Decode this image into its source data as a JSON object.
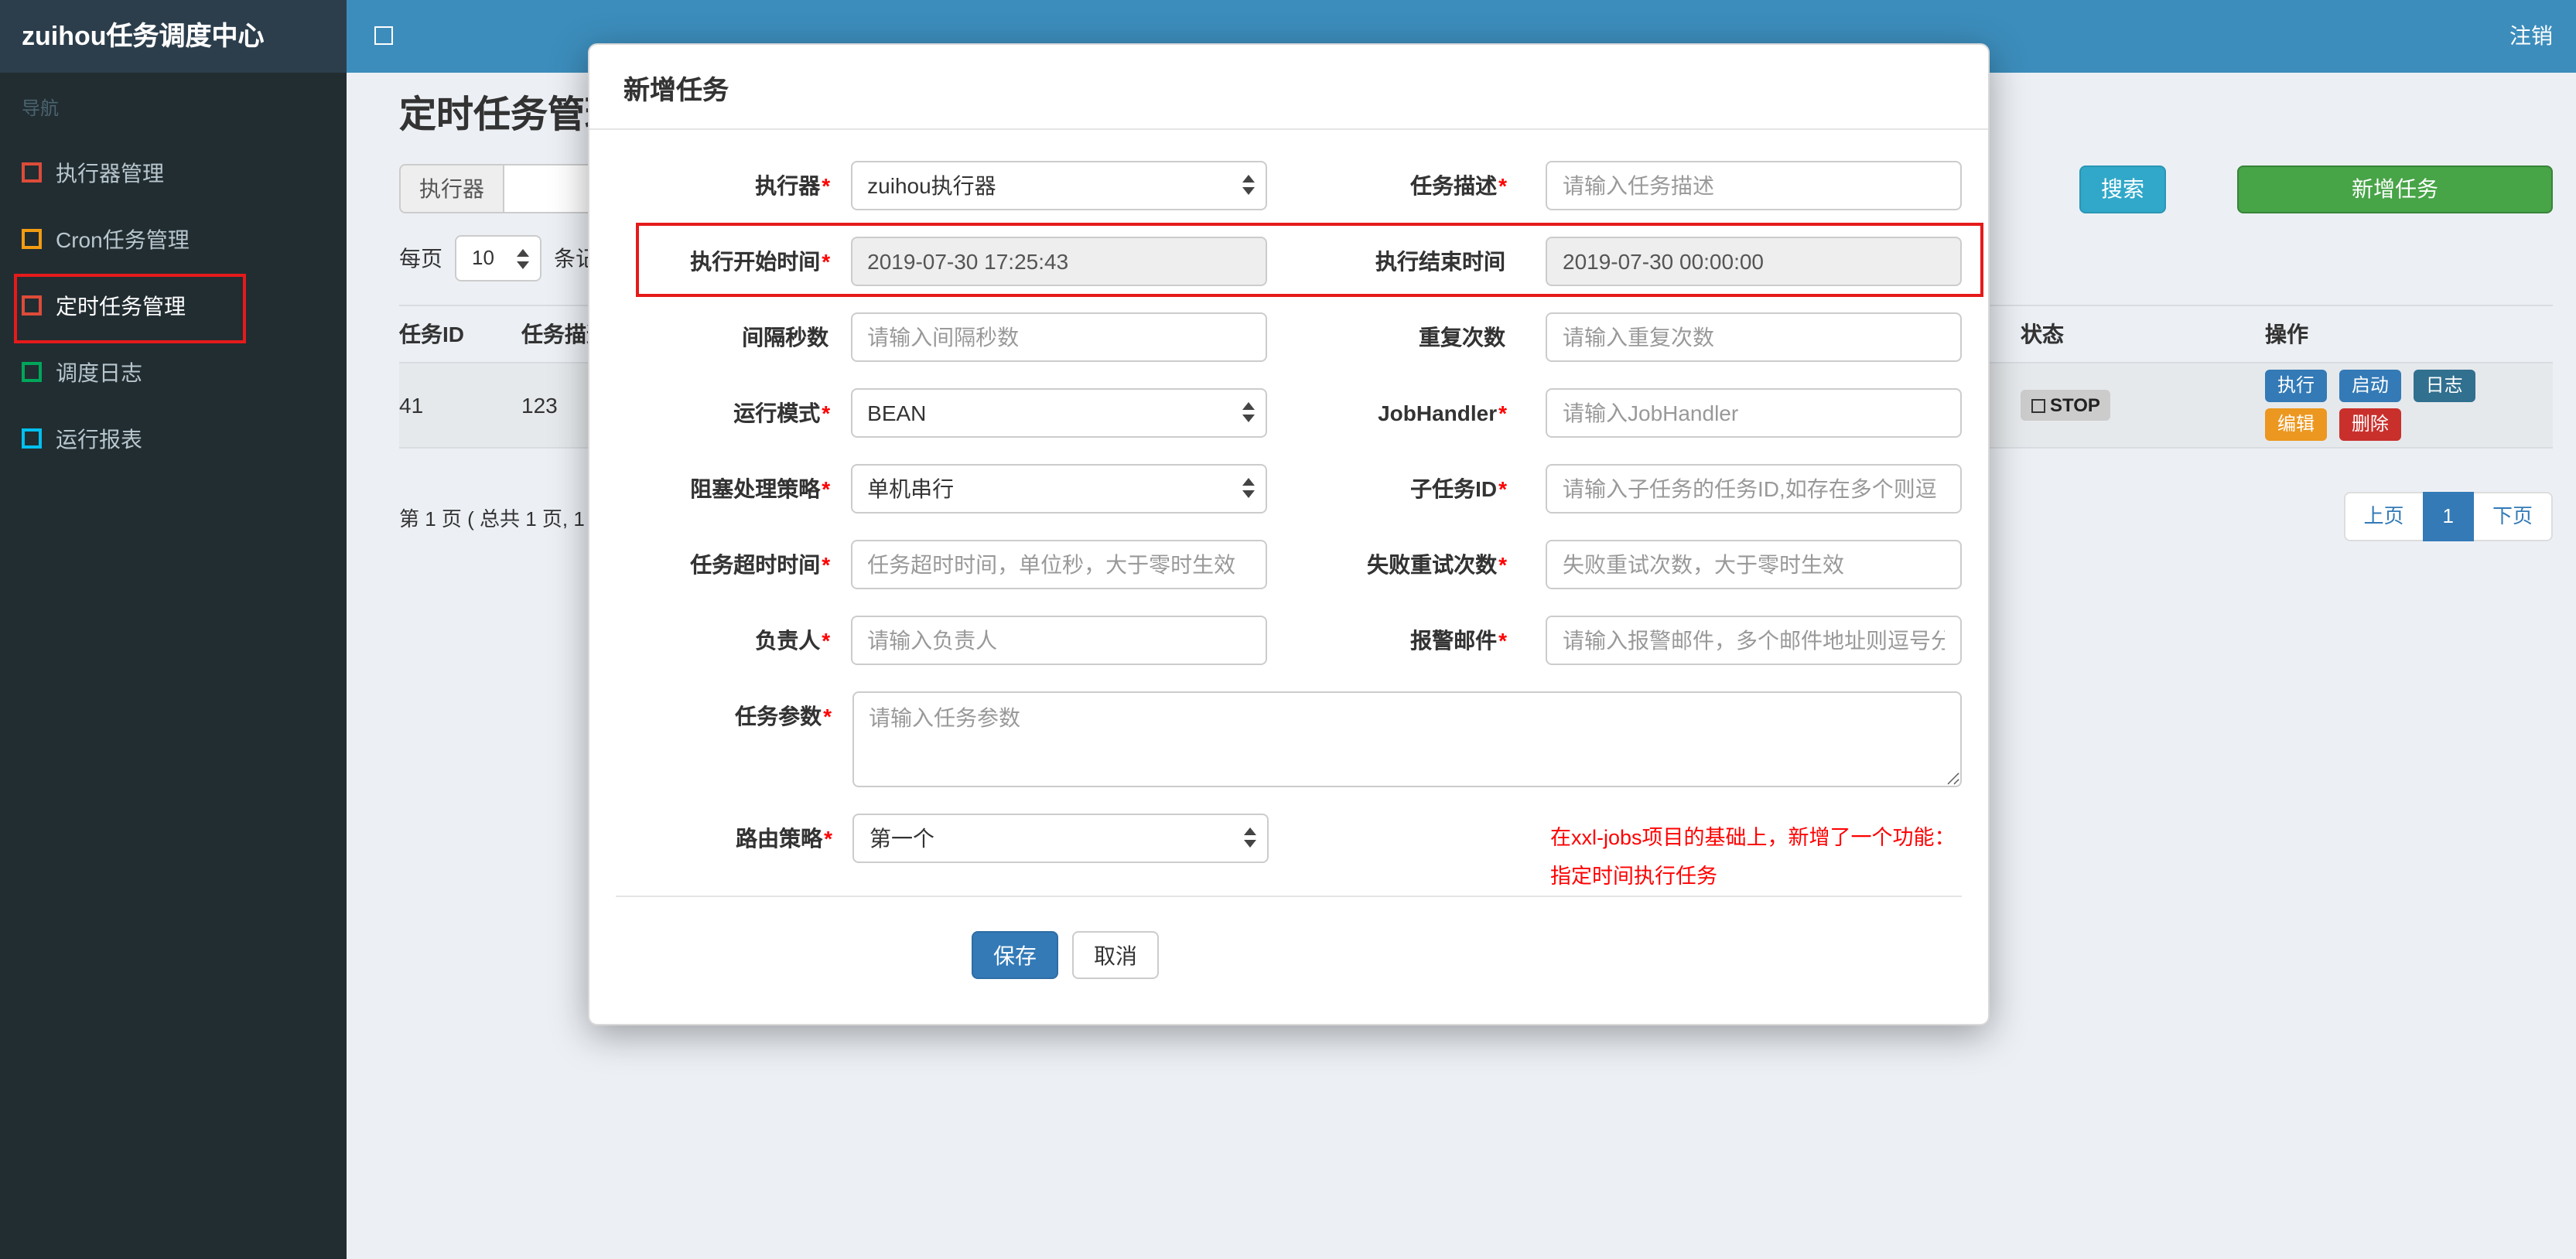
{
  "topbar": {
    "brand": "zuihou任务调度中心",
    "logout": "注销"
  },
  "sidebar": {
    "header": "导航",
    "items": [
      {
        "label": "执行器管理",
        "color": "#dd4b39",
        "active": false
      },
      {
        "label": "Cron任务管理",
        "color": "#f39c12",
        "active": false
      },
      {
        "label": "定时任务管理",
        "color": "#dd4b39",
        "active": true
      },
      {
        "label": "调度日志",
        "color": "#00a65a",
        "active": false
      },
      {
        "label": "运行报表",
        "color": "#00c0ef",
        "active": false
      }
    ]
  },
  "main": {
    "title": "定时任务管理",
    "toolbar": {
      "executor_label": "执行器",
      "search_button": "搜索",
      "add_button": "新增任务"
    },
    "page_size": {
      "prefix": "每页",
      "value": "10",
      "suffix": "条记录"
    },
    "table": {
      "headers": [
        "任务ID",
        "任务描述",
        "状态",
        "操作"
      ],
      "row": {
        "id": "41",
        "desc": "123",
        "status": "STOP",
        "actions": [
          "执行",
          "启动",
          "日志",
          "编辑",
          "删除"
        ]
      }
    },
    "pagination": {
      "summary": "第 1 页 ( 总共 1 页, 1",
      "prev": "上页",
      "current": "1",
      "next": "下页"
    }
  },
  "modal": {
    "title": "新增任务",
    "rows": [
      {
        "left": {
          "label": "执行器",
          "req": "*",
          "type": "select",
          "value": "zuihou执行器"
        },
        "right": {
          "label": "任务描述",
          "req": "*",
          "type": "input",
          "placeholder": "请输入任务描述"
        }
      },
      {
        "left": {
          "label": "执行开始时间",
          "req": "*",
          "type": "readonly",
          "value": "2019-07-30 17:25:43"
        },
        "right": {
          "label": "执行结束时间",
          "type": "readonly",
          "value": "2019-07-30 00:00:00"
        },
        "highlighted": true
      },
      {
        "left": {
          "label": "间隔秒数",
          "type": "input",
          "placeholder": "请输入间隔秒数"
        },
        "right": {
          "label": "重复次数",
          "type": "input",
          "placeholder": "请输入重复次数"
        }
      },
      {
        "left": {
          "label": "运行模式",
          "req": "*",
          "type": "select",
          "value": "BEAN"
        },
        "right": {
          "label": "JobHandler",
          "req": "*",
          "type": "input",
          "placeholder": "请输入JobHandler"
        }
      },
      {
        "left": {
          "label": "阻塞处理策略",
          "req": "*",
          "type": "select",
          "value": "单机串行"
        },
        "right": {
          "label": "子任务ID",
          "req": "*",
          "type": "input",
          "placeholder": "请输入子任务的任务ID,如存在多个则逗"
        }
      },
      {
        "left": {
          "label": "任务超时时间",
          "req": "*",
          "type": "input",
          "placeholder": "任务超时时间，单位秒，大于零时生效"
        },
        "right": {
          "label": "失败重试次数",
          "req": "*",
          "type": "input",
          "placeholder": "失败重试次数，大于零时生效"
        }
      },
      {
        "left": {
          "label": "负责人",
          "req": "*",
          "type": "input",
          "placeholder": "请输入负责人"
        },
        "right": {
          "label": "报警邮件",
          "req": "*",
          "type": "input",
          "placeholder": "请输入报警邮件，多个邮件地址则逗号分"
        }
      }
    ],
    "params": {
      "label": "任务参数",
      "req": "*",
      "placeholder": "请输入任务参数"
    },
    "route": {
      "label": "路由策略",
      "req": "*",
      "value": "第一个"
    },
    "note_line1": "在xxl-jobs项目的基础上，新增了一个功能：",
    "note_line2": "指定时间执行任务",
    "save": "保存",
    "cancel": "取消"
  },
  "colors": {
    "navbar": "#3c8dbc",
    "brand_bg": "#2c3e4c",
    "sidebar_bg": "#222d32",
    "primary": "#337ab7",
    "success": "#47a447",
    "info": "#31a8c9",
    "warning": "#ec971f",
    "danger": "#c9302c",
    "annotation_red": "#e61a1a"
  }
}
